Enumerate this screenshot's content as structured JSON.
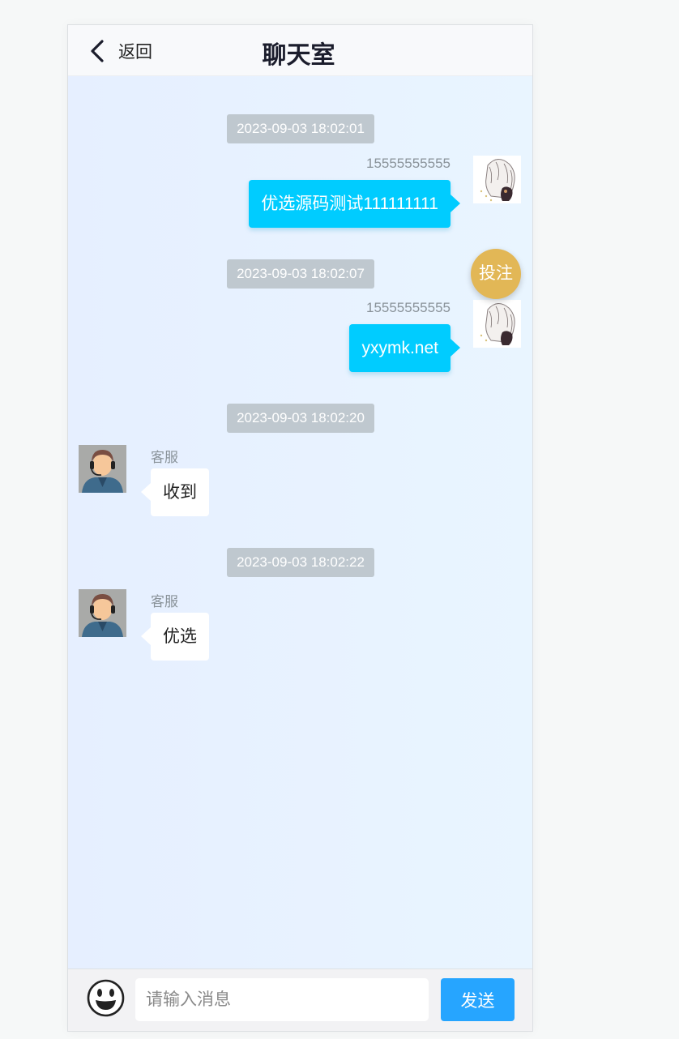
{
  "header": {
    "back_label": "返回",
    "title": "聊天室",
    "back_icon": "chevron-left-icon"
  },
  "messages": [
    {
      "timestamp": "2023-09-03 18:02:01",
      "sender": "15555555555",
      "text": "优选源码测试111111111",
      "side": "right"
    },
    {
      "timestamp": "2023-09-03 18:02:07",
      "sender": "15555555555",
      "text": "yxymk.net",
      "side": "right"
    },
    {
      "timestamp": "2023-09-03 18:02:20",
      "sender": "客服",
      "text": "收到",
      "side": "left"
    },
    {
      "timestamp": "2023-09-03 18:02:22",
      "sender": "客服",
      "text": "优选",
      "side": "left"
    }
  ],
  "floating_button": {
    "label": "投注",
    "color": "#e2b756"
  },
  "footer": {
    "emoji_icon": "smiley-face-icon",
    "input_placeholder": "请输入消息",
    "send_label": "发送"
  },
  "colors": {
    "my_bubble": "#00ccff",
    "their_bubble": "#ffffff",
    "timestamp_bg": "#bfc8cf",
    "send_button": "#26a5ff"
  }
}
